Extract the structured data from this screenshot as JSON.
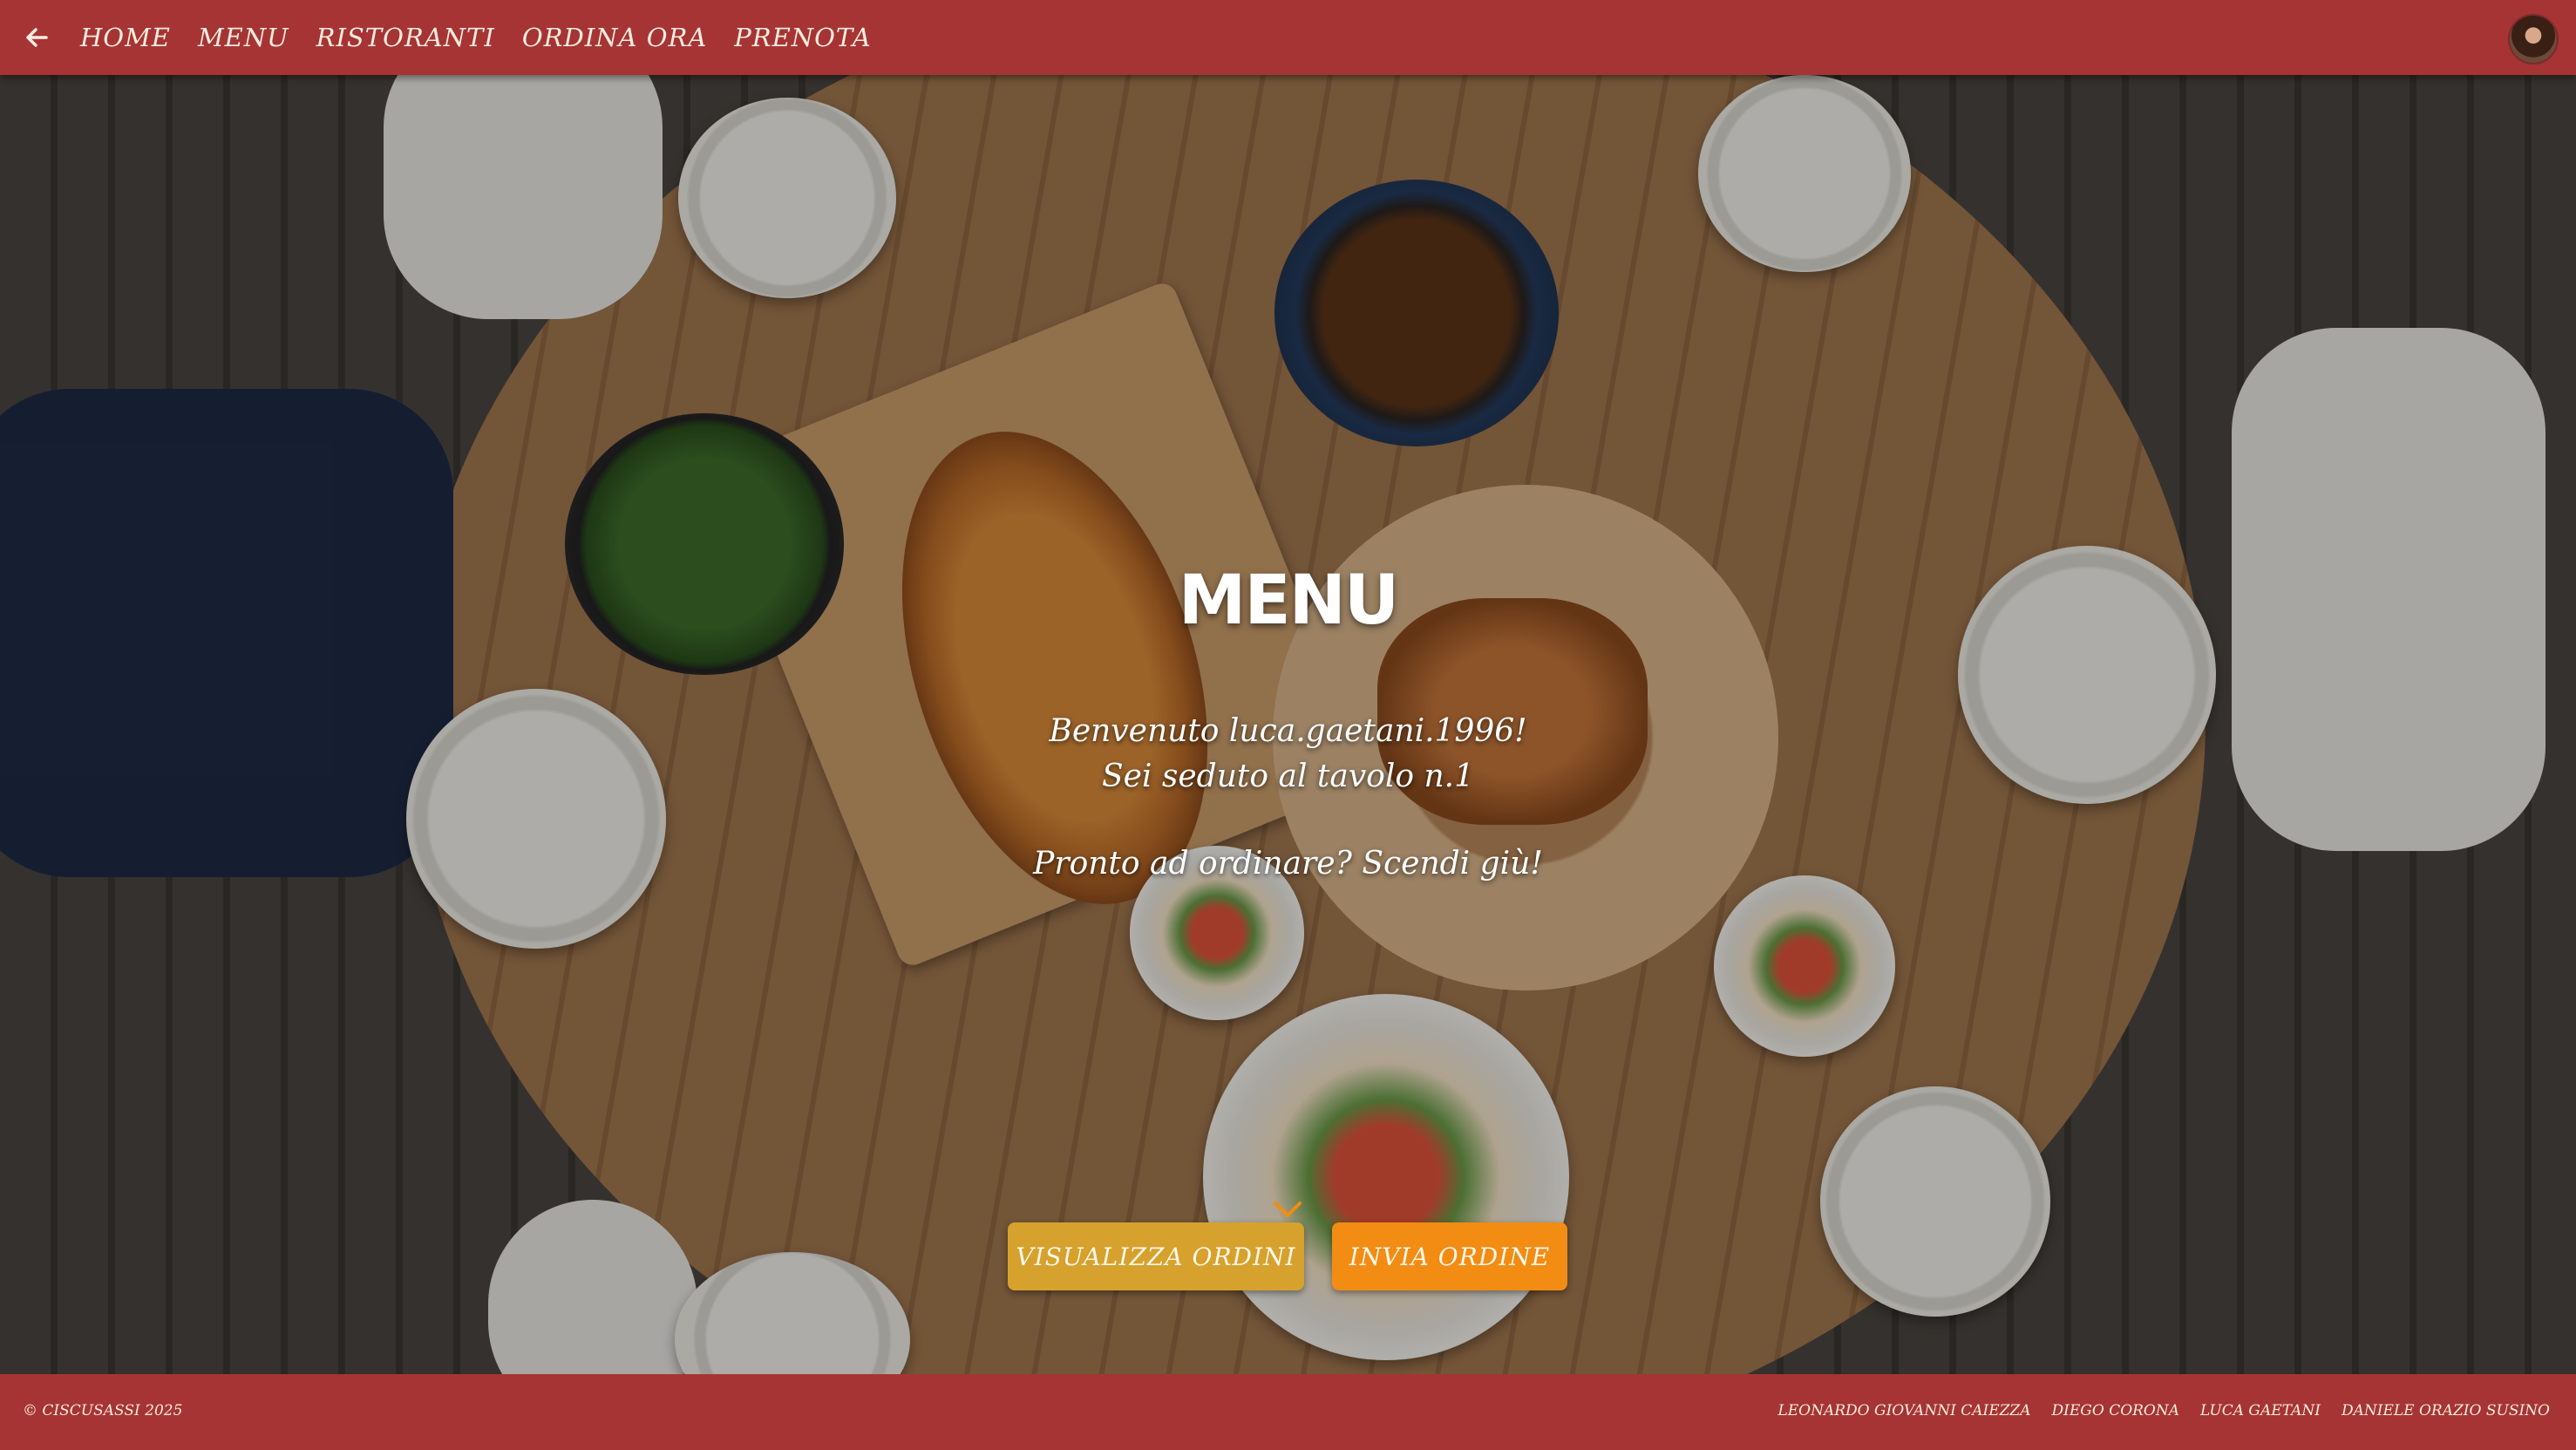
{
  "nav": {
    "back_icon": "arrow-left-icon",
    "links": [
      "HOME",
      "MENU",
      "RISTORANTI",
      "ORDINA ORA",
      "PRENOTA"
    ],
    "avatar_icon": "user-avatar"
  },
  "hero": {
    "title": "MENU",
    "welcome_line1": "Benvenuto luca.gaetani.1996!",
    "welcome_line2": "Sei seduto al tavolo n.1",
    "welcome_line3": "Pronto ad ordinare? Scendi giù!",
    "scroll_icon": "chevron-down-icon"
  },
  "actions": {
    "view_orders": "VISUALIZZA ORDINI",
    "send_order": "INVIA ORDINE"
  },
  "footer": {
    "copyright": "© CISCUSASSI 2025",
    "authors": [
      "LEONARDO GIOVANNI CAIEZZA",
      "DIEGO CORONA",
      "LUCA GAETANI",
      "DANIELE ORAZIO SUSINO"
    ]
  },
  "colors": {
    "primary": "#a63434",
    "view_button": "#d6a12c",
    "send_button": "#f28c13",
    "nav_text": "#fbecdf"
  }
}
